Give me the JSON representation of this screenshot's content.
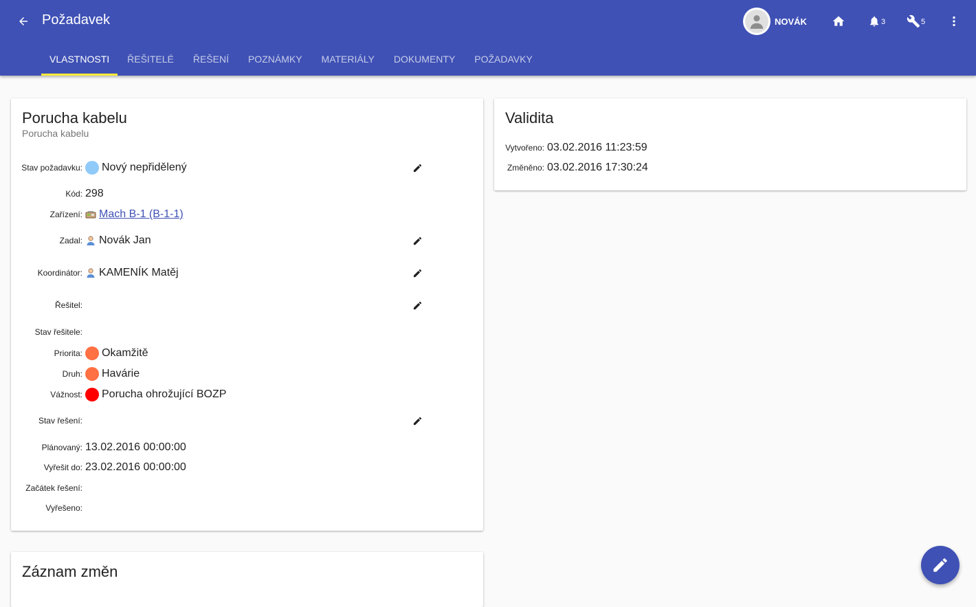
{
  "header": {
    "title": "Požadavek",
    "user_name": "NOVÁK",
    "notifications_count": "3",
    "tools_count": "5",
    "colors": {
      "primary": "#3f51b5",
      "tab_indicator": "#ffeb3b"
    }
  },
  "tabs": [
    {
      "label": "VLASTNOSTI",
      "active": true
    },
    {
      "label": "ŘEŠITELÉ"
    },
    {
      "label": "ŘEŠENÍ"
    },
    {
      "label": "POZNÁMKY"
    },
    {
      "label": "MATERIÁLY"
    },
    {
      "label": "DOKUMENTY"
    },
    {
      "label": "POŽADAVKY"
    }
  ],
  "request": {
    "title": "Porucha kabelu",
    "subtitle": "Porucha kabelu",
    "fields": {
      "stav_pozadavku": {
        "label": "Stav požadavku:",
        "value": "Nový nepřidělený",
        "color": "#90caf9"
      },
      "kod": {
        "label": "Kód:",
        "value": "298"
      },
      "zarizeni": {
        "label": "Zařízení:",
        "value": "Mach B-1 (B-1-1)"
      },
      "zadal": {
        "label": "Zadal:",
        "value": "Novák Jan"
      },
      "koordinator": {
        "label": "Koordinátor:",
        "value": "KAMENÍK Matěj"
      },
      "resitel": {
        "label": "Řešitel:",
        "value": ""
      },
      "stav_resitele": {
        "label": "Stav řešitele:",
        "value": ""
      },
      "priorita": {
        "label": "Priorita:",
        "value": "Okamžitě",
        "color": "#ff7043"
      },
      "druh": {
        "label": "Druh:",
        "value": "Havárie",
        "color": "#ff7043"
      },
      "vaznost": {
        "label": "Vážnost:",
        "value": "Porucha ohrožující BOZP",
        "color": "#ff0000"
      },
      "stav_reseni": {
        "label": "Stav řešení:",
        "value": ""
      },
      "planovany": {
        "label": "Plánovaný:",
        "value": "13.02.2016 00:00:00"
      },
      "vyresit_do": {
        "label": "Vyřešit do:",
        "value": "23.02.2016 00:00:00"
      },
      "zacatek_reseni": {
        "label": "Začátek řešení:",
        "value": ""
      },
      "vyreseno": {
        "label": "Vyřešeno:",
        "value": ""
      }
    }
  },
  "validity": {
    "title": "Validita",
    "created_label": "Vytvořeno:",
    "created_value": "03.02.2016 11:23:59",
    "modified_label": "Změněno:",
    "modified_value": "03.02.2016 17:30:24"
  },
  "changelog": {
    "title": "Záznam změn"
  }
}
